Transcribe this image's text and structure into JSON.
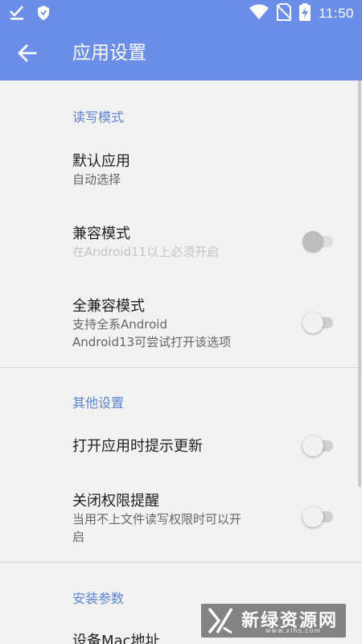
{
  "status_bar": {
    "time": "11:50",
    "icons": [
      "download-done-icon",
      "shield-icon",
      "wifi-icon",
      "no-sim-icon",
      "battery-charging-icon"
    ]
  },
  "app_bar": {
    "title": "应用设置",
    "back_icon": "arrow-back-icon"
  },
  "colors": {
    "primary": "#6b8fe9",
    "accent": "#5a83d8",
    "background": "#f2f2f2"
  },
  "sections": [
    {
      "header": "读写模式",
      "items": [
        {
          "title": "默认应用",
          "summary": "自动选择"
        },
        {
          "title": "兼容模式",
          "summary": "在Android11以上必须开启",
          "switch_on": false,
          "disabled": true
        },
        {
          "title": "全兼容模式",
          "summary_lines": [
            "支持全系Android",
            "Android13可尝试打开该选项"
          ],
          "switch_on": false
        }
      ]
    },
    {
      "header": "其他设置",
      "items": [
        {
          "title": "打开应用时提示更新",
          "switch_on": false
        },
        {
          "title": "关闭权限提醒",
          "summary_lines": [
            "当用不上文件读写权限时可以开",
            "启"
          ],
          "switch_on": false
        }
      ]
    },
    {
      "header": "安装参数",
      "items": [
        {
          "title": "设备Mac地址"
        }
      ]
    }
  ],
  "watermark": {
    "text": "新绿资源网",
    "sub": "www.xlhs.com"
  }
}
